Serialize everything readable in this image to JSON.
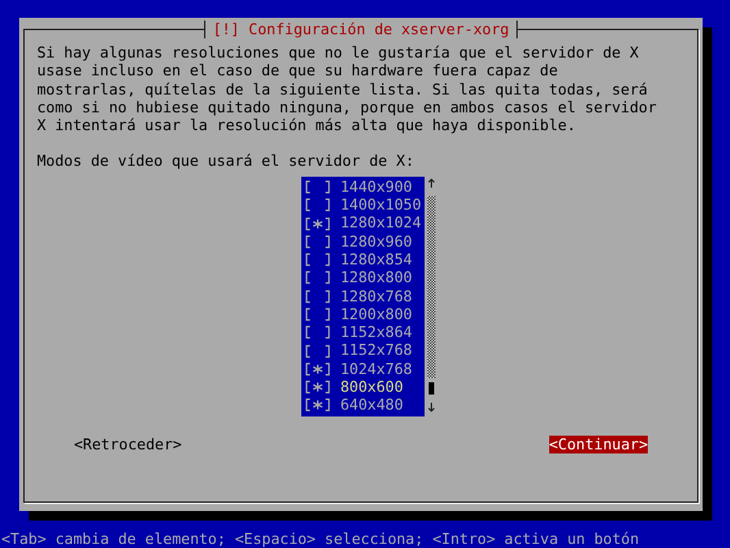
{
  "dialog": {
    "title": "[!] Configuración de xserver-xorg",
    "description": "Si hay algunas resoluciones que no le gustaría que el servidor de X\nusase incluso en el caso de que su hardware fuera capaz de\nmostrarlas, quítelas de la siguiente lista. Si las quita todas, será\ncomo si no hubiese quitado ninguna, porque en ambos casos el servidor\nX intentará usar la resolución más alta que haya disponible.",
    "prompt": "Modos de vídeo que usará el servidor de X:",
    "items": [
      {
        "label": "1440x900",
        "checked": false,
        "selected": false
      },
      {
        "label": "1400x1050",
        "checked": false,
        "selected": false
      },
      {
        "label": "1280x1024",
        "checked": true,
        "selected": false
      },
      {
        "label": "1280x960",
        "checked": false,
        "selected": false
      },
      {
        "label": "1280x854",
        "checked": false,
        "selected": false
      },
      {
        "label": "1280x800",
        "checked": false,
        "selected": false
      },
      {
        "label": "1280x768",
        "checked": false,
        "selected": false
      },
      {
        "label": "1200x800",
        "checked": false,
        "selected": false
      },
      {
        "label": "1152x864",
        "checked": false,
        "selected": false
      },
      {
        "label": "1152x768",
        "checked": false,
        "selected": false
      },
      {
        "label": "1024x768",
        "checked": true,
        "selected": false
      },
      {
        "label": "800x600",
        "checked": true,
        "selected": true
      },
      {
        "label": "640x480",
        "checked": true,
        "selected": false
      }
    ],
    "buttons": [
      {
        "label": "<Retroceder>",
        "selected": false
      },
      {
        "label": "<Continuar>",
        "selected": true
      }
    ]
  },
  "status_bar": "<Tab> cambia de elemento; <Espacio> selecciona; <Intro> activa un botón"
}
